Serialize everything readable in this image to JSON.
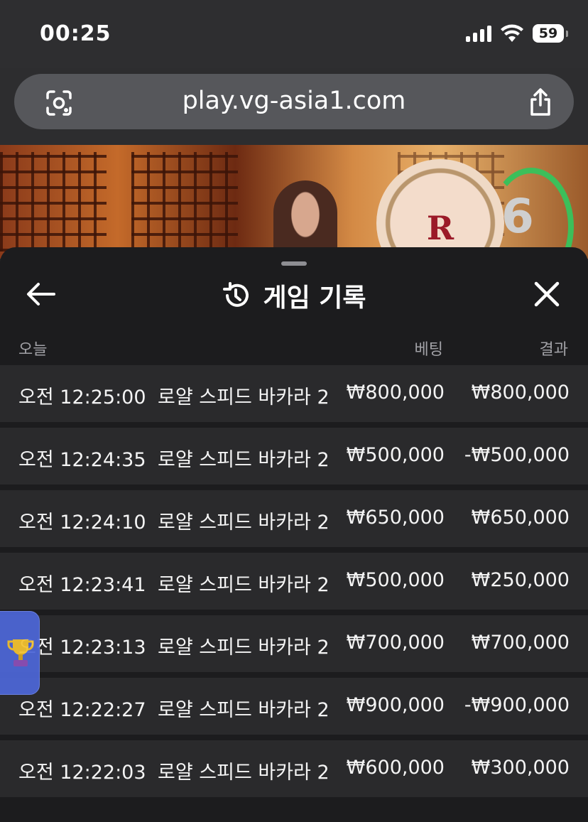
{
  "status_bar": {
    "time": "00:25",
    "battery": "59",
    "icons": [
      "cellular-signal-icon",
      "wifi-icon",
      "battery-icon"
    ]
  },
  "browser": {
    "url": "play.vg-asia1.com",
    "icons": [
      "lens-icon",
      "share-icon"
    ]
  },
  "video": {
    "emblem_letter": "R",
    "countdown": "6",
    "countdown_color": "#3cbf5a"
  },
  "sheet": {
    "title": "게임 기록",
    "icons": [
      "back-arrow-icon",
      "history-icon",
      "close-icon"
    ],
    "columns": {
      "date": "오늘",
      "bet": "베팅",
      "result": "결과"
    },
    "rows": [
      {
        "time": "오전 12:25:00",
        "game": "로얄 스피드 바카라 2",
        "bet": "₩800,000",
        "result": "₩800,000"
      },
      {
        "time": "오전 12:24:35",
        "game": "로얄 스피드 바카라 2",
        "bet": "₩500,000",
        "result": "-₩500,000"
      },
      {
        "time": "오전 12:24:10",
        "game": "로얄 스피드 바카라 2",
        "bet": "₩650,000",
        "result": "₩650,000"
      },
      {
        "time": "오전 12:23:41",
        "game": "로얄 스피드 바카라 2",
        "bet": "₩500,000",
        "result": "₩250,000"
      },
      {
        "time": "오전 12:23:13",
        "game": "로얄 스피드 바카라 2",
        "bet": "₩700,000",
        "result": "₩700,000"
      },
      {
        "time": "오전 12:22:27",
        "game": "로얄 스피드 바카라 2",
        "bet": "₩900,000",
        "result": "-₩900,000"
      },
      {
        "time": "오전 12:22:03",
        "game": "로얄 스피드 바카라 2",
        "bet": "₩600,000",
        "result": "₩300,000"
      }
    ]
  },
  "floating": {
    "icon": "trophy-icon",
    "color": "#4d67d8"
  }
}
